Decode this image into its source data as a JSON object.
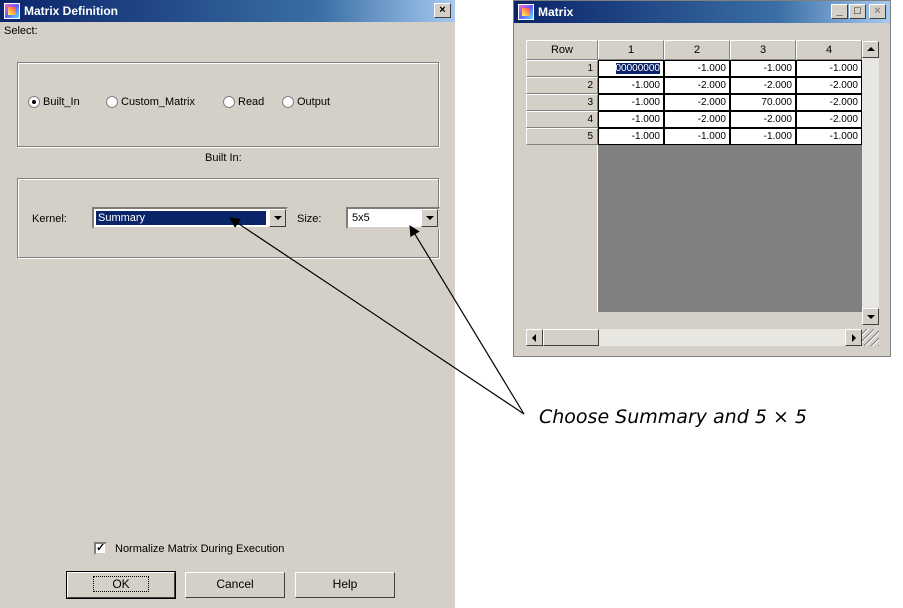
{
  "dialog": {
    "title": "Matrix Definition",
    "close_glyph": "×",
    "select_label": "Select:",
    "radio_options": [
      {
        "label": "Built_In",
        "checked": true
      },
      {
        "label": "Custom_Matrix",
        "checked": false
      },
      {
        "label": "Read",
        "checked": false
      },
      {
        "label": "Output",
        "checked": false
      }
    ],
    "built_in_label": "Built In:",
    "kernel_label": "Kernel:",
    "kernel_value": "Summary",
    "size_label": "Size:",
    "size_value": "5x5",
    "normalize_label": "Normalize Matrix During Execution",
    "normalize_checked": true,
    "check_glyph": "✓",
    "ok_label": "OK",
    "cancel_label": "Cancel",
    "help_label": "Help"
  },
  "matrix_window": {
    "title": "Matrix",
    "minimize_glyph": "_",
    "maximize_glyph": "□",
    "close_glyph": "×",
    "row_header": "Row",
    "columns": [
      "1",
      "2",
      "3",
      "4"
    ],
    "rows": [
      {
        "label": "1",
        "cells": [
          "00000000",
          "-1.000",
          "-1.000",
          "-1.000"
        ]
      },
      {
        "label": "2",
        "cells": [
          "-1.000",
          "-2.000",
          "-2.000",
          "-2.000"
        ]
      },
      {
        "label": "3",
        "cells": [
          "-1.000",
          "-2.000",
          "70.000",
          "-2.000"
        ]
      },
      {
        "label": "4",
        "cells": [
          "-1.000",
          "-2.000",
          "-2.000",
          "-2.000"
        ]
      },
      {
        "label": "5",
        "cells": [
          "-1.000",
          "-1.000",
          "-1.000",
          "-1.000"
        ]
      }
    ]
  },
  "annotation": {
    "text": "Choose Summary and 5 × 5"
  }
}
